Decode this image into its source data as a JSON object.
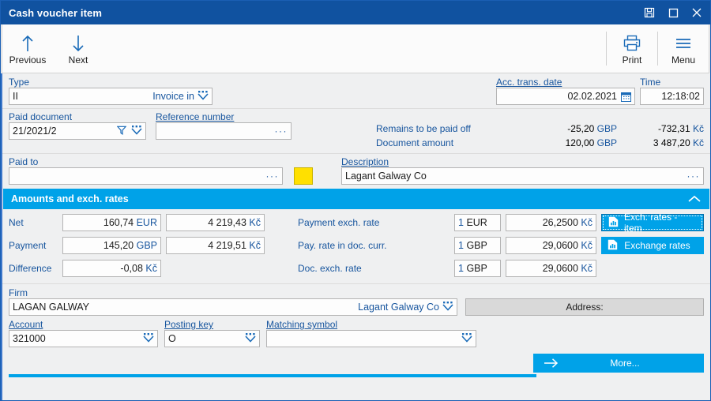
{
  "window": {
    "title": "Cash voucher item",
    "buttons": [
      {
        "name": "restore-save-button",
        "glyph": "save"
      },
      {
        "name": "maximize-button",
        "glyph": "maximize"
      },
      {
        "name": "close-button",
        "glyph": "close"
      }
    ]
  },
  "toolbar": {
    "previous_label": "Previous",
    "next_label": "Next",
    "print_label": "Print",
    "menu_label": "Menu"
  },
  "form": {
    "type_label": "Type",
    "type_value": "II",
    "type_caption": "Invoice in",
    "acc_trans_date_label": "Acc. trans. date",
    "acc_trans_date_value": "02.02.2021",
    "time_label": "Time",
    "time_value": "12:18:02",
    "paid_document_label": "Paid document",
    "paid_document_value": "21/2021/2",
    "reference_number_label": "Reference number",
    "reference_number_value": "",
    "remains_label": "Remains to be paid off",
    "remains_amount": "-25,20",
    "remains_currency": "GBP",
    "remains_local": "-732,31",
    "remains_local_currency": "Kč",
    "document_amount_label": "Document amount",
    "document_amount": "120,00",
    "document_currency": "GBP",
    "document_local": "3 487,20",
    "document_local_currency": "Kč",
    "paid_to_label": "Paid to",
    "paid_to_value": "",
    "description_label": "Description",
    "description_value": "Lagant Galway Co"
  },
  "amounts_section": {
    "header": "Amounts and exch. rates",
    "left_rows": [
      {
        "label": "Net",
        "amount": "160,74",
        "currency": "EUR",
        "local": "4 219,43",
        "local_currency": "Kč"
      },
      {
        "label": "Payment",
        "amount": "145,20",
        "currency": "GBP",
        "local": "4 219,51",
        "local_currency": "Kč"
      },
      {
        "label": "Difference",
        "amount": "-0,08",
        "currency": "Kč",
        "local": "",
        "local_currency": ""
      }
    ],
    "right_rows": [
      {
        "label": "Payment exch. rate",
        "qty": "1",
        "unit": "EUR",
        "rate": "26,2500",
        "rate_currency": "Kč"
      },
      {
        "label": "Pay. rate in doc. curr.",
        "qty": "1",
        "unit": "GBP",
        "rate": "29,0600",
        "rate_currency": "Kč"
      },
      {
        "label": "Doc. exch. rate",
        "qty": "1",
        "unit": "GBP",
        "rate": "29,0600",
        "rate_currency": "Kč"
      }
    ],
    "exch_rates_item_button": "Exch. rates - item",
    "exchange_rates_button": "Exchange rates"
  },
  "firm": {
    "firm_label": "Firm",
    "firm_value": "LAGAN GALWAY",
    "firm_caption": "Lagant Galway Co",
    "address_button": "Address:",
    "account_label": "Account",
    "account_value": "321000",
    "posting_key_label": "Posting key",
    "posting_key_value": "O",
    "matching_symbol_label": "Matching symbol",
    "matching_symbol_value": "",
    "more_button": "More..."
  },
  "colors": {
    "title_bar": "#1052a0",
    "accent_cyan": "#00a2e8",
    "label_blue": "#17559e",
    "swatch_yellow": "#ffe000"
  }
}
